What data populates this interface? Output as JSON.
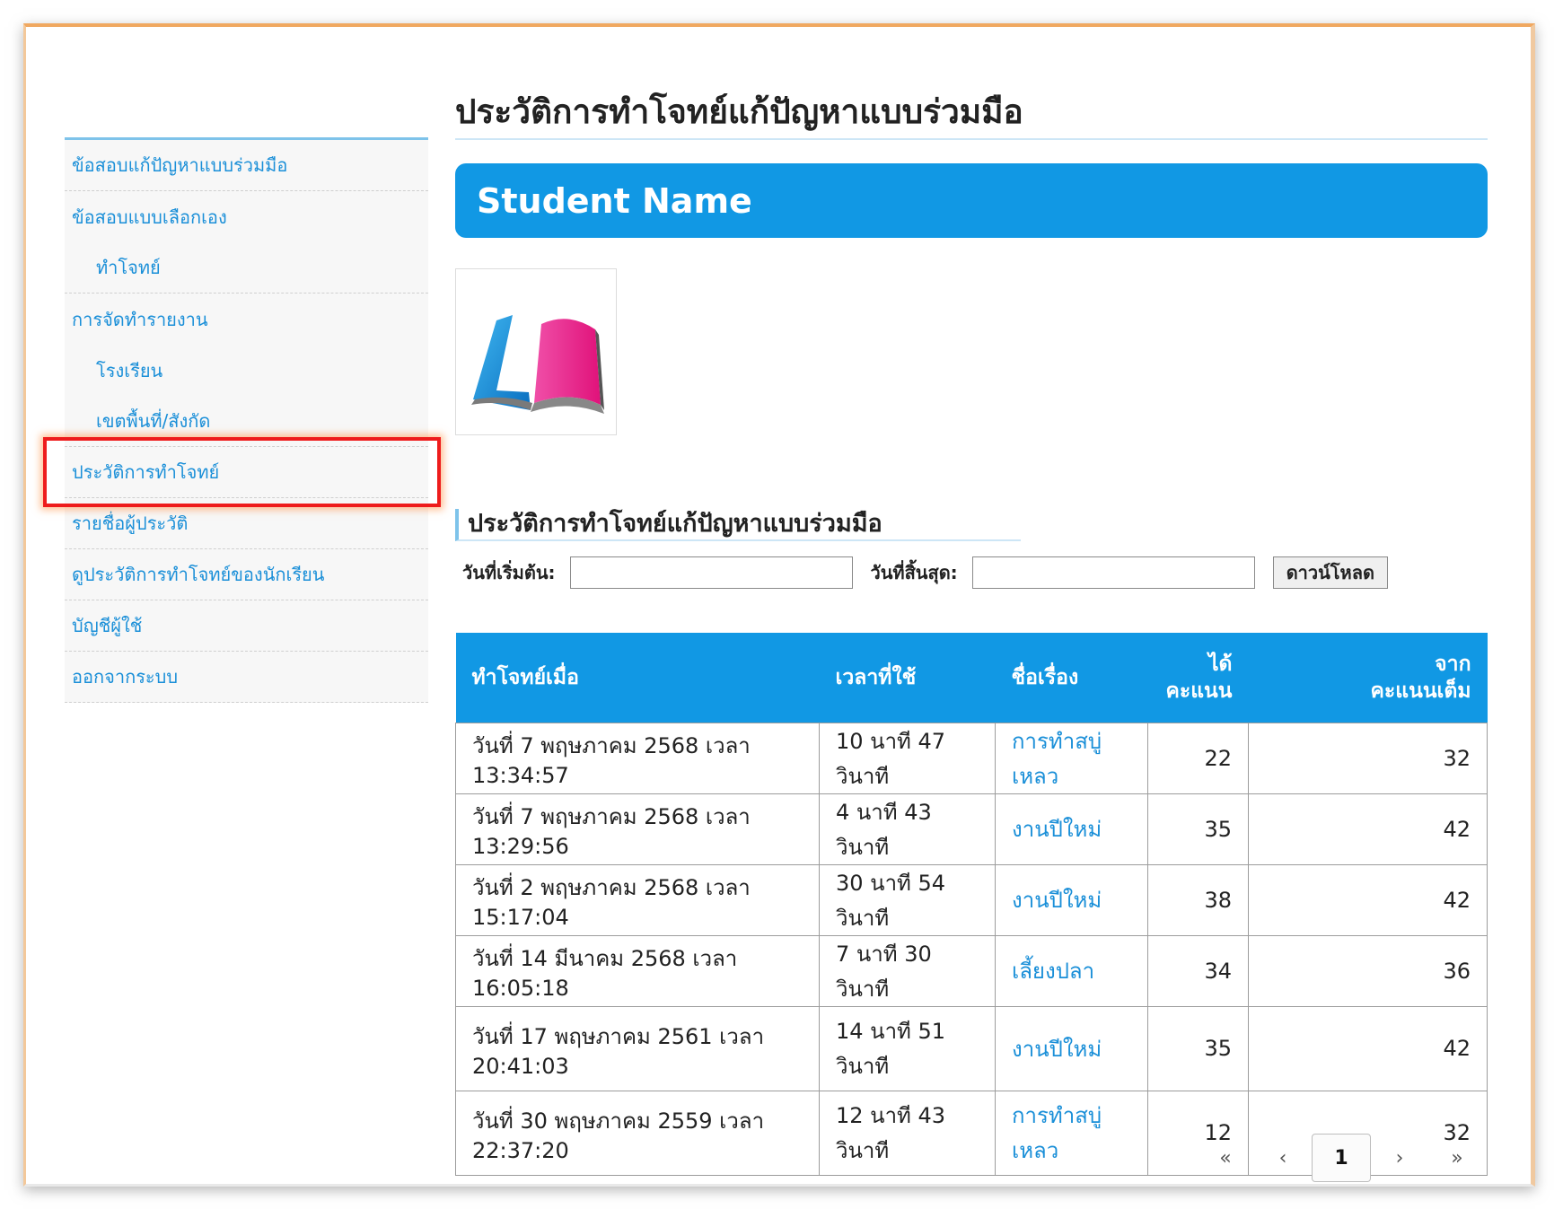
{
  "sidebar": {
    "items": [
      {
        "label": "ข้อสอบแก้ปัญหาแบบร่วมมือ"
      },
      {
        "label": "ข้อสอบแบบเลือกเอง"
      },
      {
        "label": "ทำโจทย์"
      },
      {
        "label": "การจัดทำรายงาน"
      },
      {
        "label": "โรงเรียน"
      },
      {
        "label": "เขตพื้นที่/สังกัด"
      },
      {
        "label": "ประวัติการทำโจทย์"
      },
      {
        "label": "รายชื่อผู้ประวัติ"
      },
      {
        "label": "ดูประวัติการทำโจทย์ของนักเรียน"
      },
      {
        "label": "บัญชีผู้ใช้"
      },
      {
        "label": "ออกจากระบบ"
      }
    ],
    "highlight_color": "#ee1c1c"
  },
  "main": {
    "title": "ประวัติการทำโจทย์แก้ปัญหาแบบร่วมมือ",
    "student_name": "Student Name",
    "logo_icon": "book-logo-icon",
    "section_title": "ประวัติการทำโจทย์แก้ปัญหาแบบร่วมมือ",
    "filters": {
      "start_label": "วันที่เริ่มต้น:",
      "start_value": "",
      "end_label": "วันที่สิ้นสุด:",
      "end_value": "",
      "download_label": "ดาวน์โหลด"
    },
    "table": {
      "headers": {
        "when": "ทำโจทย์เมื่อ",
        "time_used": "เวลาที่ใช้",
        "topic": "ชื่อเรื่อง",
        "score_line1": "ได้",
        "score_line2": "คะแนน",
        "full_line1": "จาก",
        "full_line2": "คะแนนเต็ม"
      },
      "rows": [
        {
          "when": "วันที่ 7 พฤษภาคม 2568 เวลา 13:34:57",
          "time_used": "10 นาที 47 วินาที",
          "topic": "การทำสบู่เหลว",
          "score": "22",
          "full": "32"
        },
        {
          "when": "วันที่ 7 พฤษภาคม 2568 เวลา 13:29:56",
          "time_used": "4 นาที 43 วินาที",
          "topic": "งานปีใหม่",
          "score": "35",
          "full": "42"
        },
        {
          "when": "วันที่ 2 พฤษภาคม 2568 เวลา 15:17:04",
          "time_used": "30 นาที 54 วินาที",
          "topic": "งานปีใหม่",
          "score": "38",
          "full": "42"
        },
        {
          "when": "วันที่ 14 มีนาคม 2568 เวลา 16:05:18",
          "time_used": "7 นาที 30 วินาที",
          "topic": "เลี้ยงปลา",
          "score": "34",
          "full": "36"
        },
        {
          "when": "วันที่ 17 พฤษภาคม 2561 เวลา 20:41:03",
          "time_used": "14 นาที 51 วินาที",
          "topic": "งานปีใหม่",
          "score": "35",
          "full": "42"
        },
        {
          "when": "วันที่ 30 พฤษภาคม 2559 เวลา 22:37:20",
          "time_used": "12 นาที 43 วินาที",
          "topic": "การทำสบู่เหลว",
          "score": "12",
          "full": "32"
        }
      ]
    },
    "pager": {
      "first": "«",
      "prev": "‹",
      "current": "1",
      "next": "›",
      "last": "»"
    }
  },
  "colors": {
    "accent": "#1198e4",
    "link": "#1a8fd8"
  }
}
